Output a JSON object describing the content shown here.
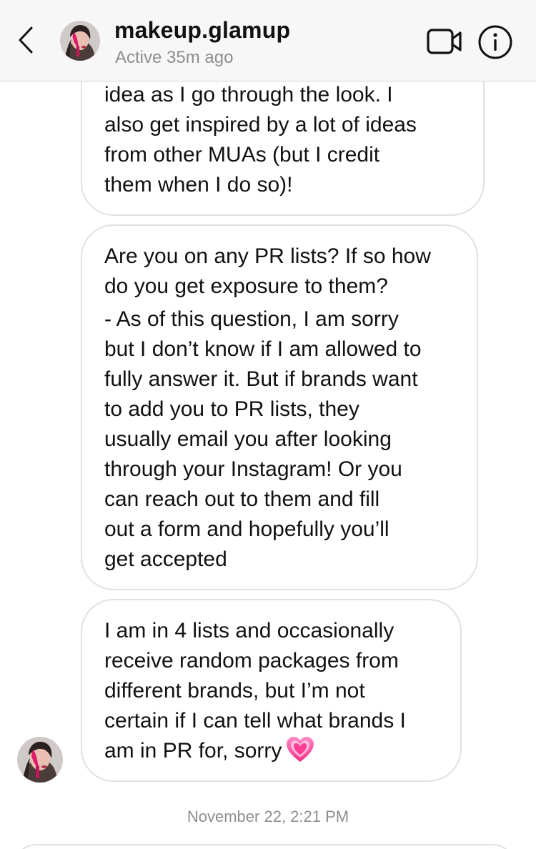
{
  "header": {
    "username": "makeup.glamup",
    "status": "Active 35m ago",
    "icons": {
      "back": "chevron-left-icon",
      "video": "video-call-icon",
      "info": "info-icon"
    }
  },
  "messages": [
    {
      "text": "idea as I go through the look. I\nalso get inspired by a lot of ideas\nfrom other MUAs (but I credit\nthem when I do so)!"
    },
    {
      "question": "Are you on any PR lists? If so how\ndo you get exposure to them?",
      "answer": "- As of this question, I am sorry\nbut I don’t know if I am allowed to\nfully answer it. But if brands want\nto add you to PR lists, they\nusually email you after looking\nthrough your Instagram! Or you\ncan reach out to them and  fill\nout a form and hopefully you’ll\nget accepted"
    },
    {
      "text": "I am in 4 lists and occasionally\nreceive random packages from\ndifferent brands, but I’m not\ncertain if I can tell what brands I\nam in PR for, sorry",
      "emoji": "heart-emoji"
    }
  ],
  "timestamp": "November 22, 2:21 PM",
  "colors": {
    "header_bg": "#f7f7f7",
    "bubble_border": "#e1e1e1",
    "muted_text": "#8e8e8e",
    "heart_pink": "#ff4fa3"
  }
}
